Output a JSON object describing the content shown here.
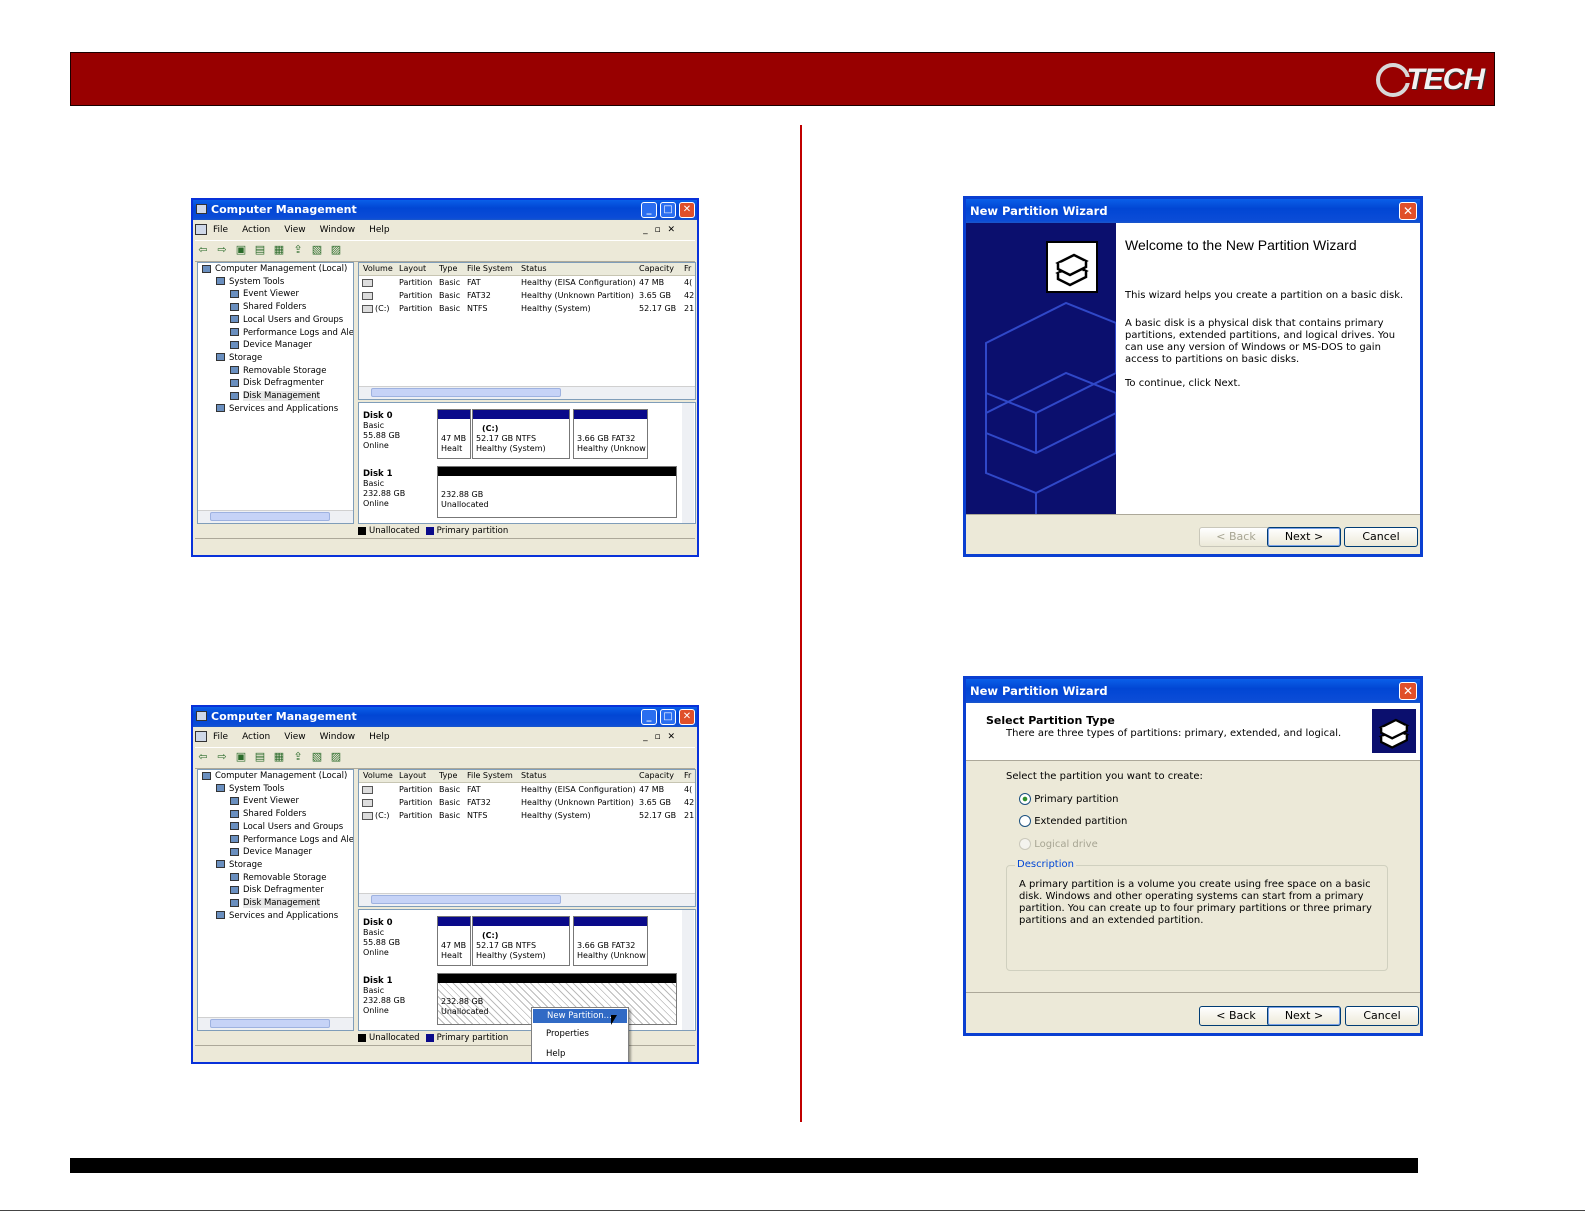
{
  "brand": {
    "logo_text": "TECH",
    "logo_letter": "G"
  },
  "cm_window": {
    "title": "Computer Management",
    "menu": [
      "File",
      "Action",
      "View",
      "Window",
      "Help"
    ],
    "tree": [
      {
        "label": "Computer Management (Local)",
        "level": 0
      },
      {
        "label": "System Tools",
        "level": 1
      },
      {
        "label": "Event Viewer",
        "level": 2
      },
      {
        "label": "Shared Folders",
        "level": 2
      },
      {
        "label": "Local Users and Groups",
        "level": 2
      },
      {
        "label": "Performance Logs and Alerts",
        "level": 2
      },
      {
        "label": "Device Manager",
        "level": 2
      },
      {
        "label": "Storage",
        "level": 1
      },
      {
        "label": "Removable Storage",
        "level": 2
      },
      {
        "label": "Disk Defragmenter",
        "level": 2
      },
      {
        "label": "Disk Management",
        "level": 2
      },
      {
        "label": "Services and Applications",
        "level": 1
      }
    ],
    "columns": [
      "Volume",
      "Layout",
      "Type",
      "File System",
      "Status",
      "Capacity",
      "Fr"
    ],
    "volumes": [
      {
        "volume": "",
        "layout": "Partition",
        "type": "Basic",
        "fs": "FAT",
        "status": "Healthy (EISA Configuration)",
        "capacity": "47 MB",
        "free": "4("
      },
      {
        "volume": "",
        "layout": "Partition",
        "type": "Basic",
        "fs": "FAT32",
        "status": "Healthy (Unknown Partition)",
        "capacity": "3.65 GB",
        "free": "42"
      },
      {
        "volume": "(C:)",
        "layout": "Partition",
        "type": "Basic",
        "fs": "NTFS",
        "status": "Healthy (System)",
        "capacity": "52.17 GB",
        "free": "21"
      }
    ],
    "disk0": {
      "name": "Disk 0",
      "type": "Basic",
      "size": "55.88 GB",
      "state": "Online",
      "parts": [
        {
          "line1": "",
          "line2": "47 MB",
          "line3": "Healt"
        },
        {
          "line1": "(C:)",
          "line2": "52.17 GB NTFS",
          "line3": "Healthy (System)"
        },
        {
          "line1": "",
          "line2": "3.66 GB FAT32",
          "line3": "Healthy (Unknow"
        }
      ]
    },
    "disk1": {
      "name": "Disk 1",
      "type": "Basic",
      "size": "232.88 GB",
      "state": "Online",
      "part": {
        "line1": "232.88 GB",
        "line2": "Unallocated"
      }
    },
    "legend": {
      "unallocated": "Unallocated",
      "primary": "Primary partition"
    },
    "context_menu": [
      "New Partition...",
      "Properties",
      "Help"
    ]
  },
  "wizard1": {
    "title": "New Partition Wizard",
    "heading": "Welcome to the New Partition Wizard",
    "p1": "This wizard helps you create a partition on a basic disk.",
    "p2": "A basic disk is a physical disk that contains primary partitions, extended partitions, and logical drives. You can use any version of Windows or MS-DOS to gain access to partitions on basic disks.",
    "p3": "To continue, click Next.",
    "buttons": {
      "back": "< Back",
      "next": "Next >",
      "cancel": "Cancel"
    }
  },
  "wizard2": {
    "title": "New Partition Wizard",
    "heading": "Select Partition Type",
    "subheading": "There are three types of partitions: primary, extended, and logical.",
    "prompt": "Select the partition you want to create:",
    "options": [
      "Primary partition",
      "Extended partition",
      "Logical drive"
    ],
    "selected": "Primary partition",
    "description_label": "Description",
    "description": "A primary partition is a volume you create using free space on a basic disk. Windows and other operating systems can start from a primary partition. You can create up to four primary partitions or three primary partitions and an extended partition.",
    "buttons": {
      "back": "< Back",
      "next": "Next >",
      "cancel": "Cancel"
    }
  },
  "colors": {
    "header": "#980000",
    "divider": "#c00000",
    "xp_blue": "#0831d9",
    "primary_partition": "#0a0a8a"
  }
}
